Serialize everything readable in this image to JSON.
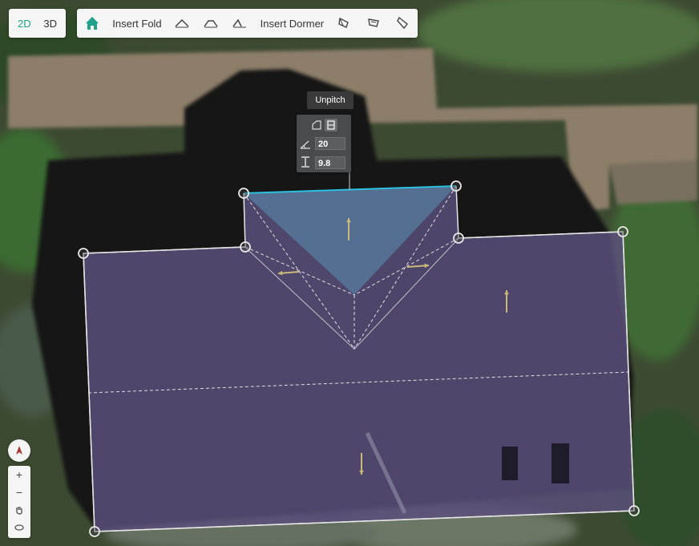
{
  "view_toggle": {
    "btn_2d": "2D",
    "btn_3d": "3D",
    "active": "2D"
  },
  "toolbar": {
    "home_icon": "home-icon",
    "insert_fold": "Insert Fold",
    "fold_icons": [
      "fold-gable-icon",
      "fold-hip-icon",
      "fold-shed-icon"
    ],
    "insert_dormer": "Insert Dormer",
    "dormer_icons": [
      "dormer-gable-icon",
      "dormer-hip-icon",
      "dormer-shed-icon"
    ]
  },
  "tooltip": {
    "text": "Unpitch"
  },
  "pitch_panel": {
    "pitch_value": "20",
    "height_value": "9.8",
    "pitch_icon": "angle-icon",
    "height_icon": "height-icon"
  },
  "map_controls": {
    "compass": "compass-icon",
    "zoom_in": "+",
    "zoom_out": "−",
    "pan_icon": "hand-icon",
    "tilt_icon": "orbit-icon"
  },
  "colors": {
    "accent": "#21a08a",
    "roof_fill": "#5a4f7a",
    "selected_face": "#5f7fa7",
    "edge_highlight": "#2bc1e0",
    "arrow": "#c8b97a"
  }
}
